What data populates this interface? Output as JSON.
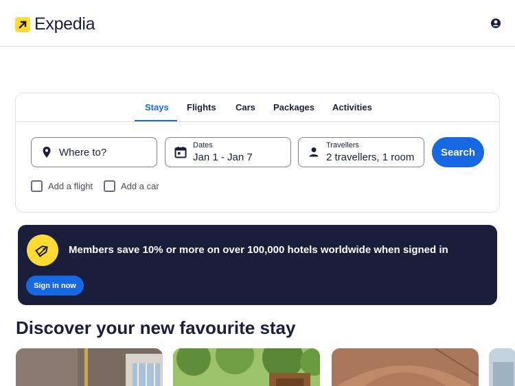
{
  "header": {
    "brand": "Expedia",
    "account_icon": "account-circle-icon"
  },
  "search": {
    "tabs": [
      {
        "label": "Stays",
        "active": true
      },
      {
        "label": "Flights",
        "active": false
      },
      {
        "label": "Cars",
        "active": false
      },
      {
        "label": "Packages",
        "active": false
      },
      {
        "label": "Activities",
        "active": false
      }
    ],
    "destination": {
      "placeholder": "Where to?",
      "icon": "location-pin-icon"
    },
    "dates": {
      "label": "Dates",
      "value": "Jan 1 - Jan 7",
      "icon": "calendar-icon"
    },
    "travellers": {
      "label": "Travellers",
      "value": "2 travellers, 1 room",
      "icon": "person-icon"
    },
    "search_button": "Search",
    "add_flight": "Add a flight",
    "add_car": "Add a car"
  },
  "promo": {
    "text": "Members save 10% or more on over 100,000 hotels worldwide when signed in",
    "button": "Sign in now",
    "icon": "price-tag-icon"
  },
  "discover": {
    "title": "Discover your new favourite stay"
  },
  "colors": {
    "brand_blue": "#1668e3",
    "navy": "#191e3b",
    "yellow": "#fddb32"
  }
}
